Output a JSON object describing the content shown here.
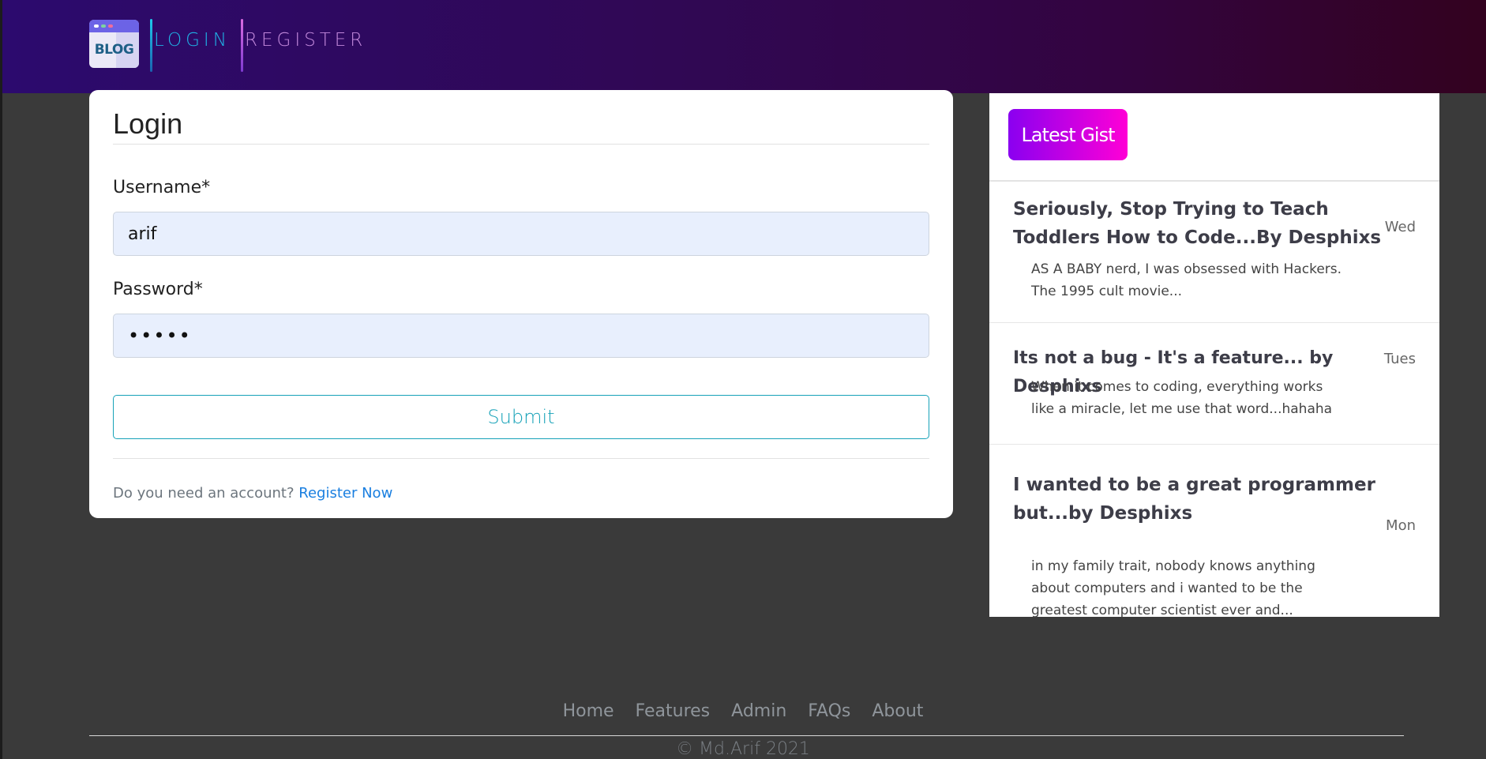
{
  "header": {
    "logo_text": "BLOG",
    "nav": {
      "login": "LOGIN",
      "register": "REGISTER"
    }
  },
  "login_form": {
    "title": "Login",
    "username_label": "Username*",
    "username_value": "arif",
    "password_label": "Password*",
    "password_value": "•••••",
    "submit_label": "Submit",
    "account_prompt": "Do you need an account?",
    "register_link": "Register Now"
  },
  "sidebar": {
    "badge": "Latest Gist",
    "gists": [
      {
        "title": "Seriously, Stop Trying to Teach Toddlers How to Code...By Desphixs",
        "day": "Wed",
        "excerpt": "AS A BABY nerd, I was obsessed with Hackers. The 1995 cult movie..."
      },
      {
        "title": "Its not a bug - It's a feature... by Desphixs",
        "day": "Tues",
        "excerpt": "When it comes to coding, everything works like a miracle, let me use that word...hahaha"
      },
      {
        "title": "I wanted to be a great programmer but...by Desphixs",
        "day": "Mon",
        "excerpt": "in my family trait, nobody knows anything about computers and i wanted to be the greatest computer scientist ever and..."
      }
    ]
  },
  "footer": {
    "links": [
      "Home",
      "Features",
      "Admin",
      "FAQs",
      "About"
    ],
    "copyright": "© Md.Arif 2021"
  },
  "colors": {
    "header_gradient_start": "#2c0a6e",
    "header_gradient_end": "#33021f",
    "page_background": "#3a3a3a",
    "submit_accent": "#17a2b8",
    "link_blue": "#1a7fe0",
    "badge_gradient_start": "#8a00f0",
    "badge_gradient_end": "#ff00d6"
  }
}
